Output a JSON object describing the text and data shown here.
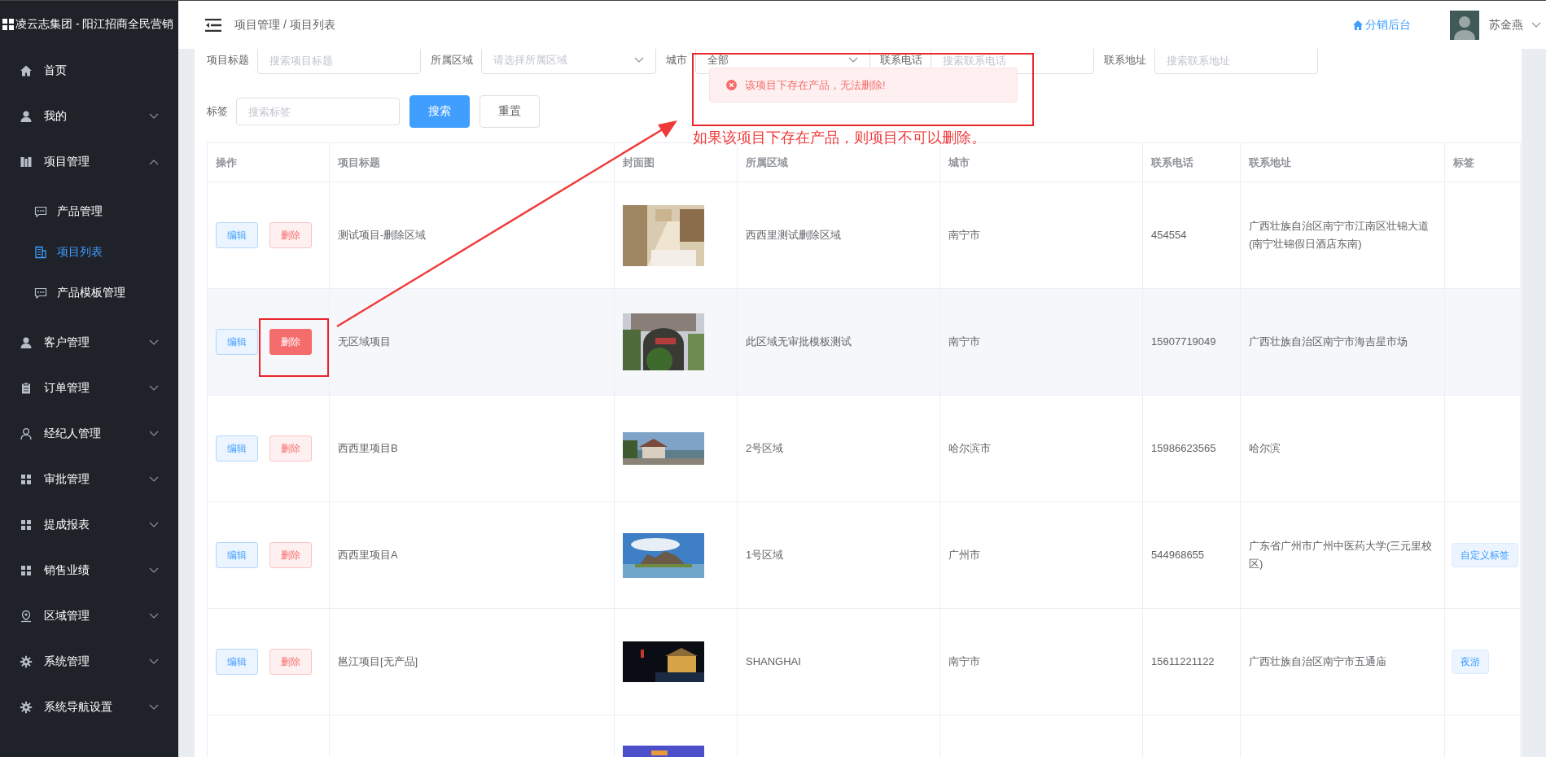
{
  "brand": {
    "title": "凌云志集团 - 阳江招商全民营销"
  },
  "sidebar": {
    "items": [
      {
        "label": "首页"
      },
      {
        "label": "我的",
        "expanded": false
      },
      {
        "label": "项目管理",
        "expanded": true,
        "children": [
          {
            "label": "产品管理",
            "selected": false
          },
          {
            "label": "项目列表",
            "selected": true
          },
          {
            "label": "产品模板管理",
            "selected": false
          }
        ]
      },
      {
        "label": "客户管理",
        "expanded": false
      },
      {
        "label": "订单管理",
        "expanded": false
      },
      {
        "label": "经纪人管理",
        "expanded": false
      },
      {
        "label": "审批管理",
        "expanded": false
      },
      {
        "label": "提成报表",
        "expanded": false
      },
      {
        "label": "销售业绩",
        "expanded": false
      },
      {
        "label": "区域管理",
        "expanded": false
      },
      {
        "label": "系统管理",
        "expanded": false
      },
      {
        "label": "系统导航设置",
        "expanded": false
      }
    ]
  },
  "header": {
    "breadcrumb": "项目管理 / 项目列表",
    "link": "分销后台",
    "user": "苏金燕"
  },
  "filters": [
    {
      "label": "项目标题",
      "placeholder": "搜索项目标题",
      "kind": "input"
    },
    {
      "label": "所属区域",
      "placeholder": "请选择所属区域",
      "kind": "select"
    },
    {
      "label": "城市",
      "value": "全部",
      "kind": "select"
    },
    {
      "label": "联系电话",
      "placeholder": "搜索联系电话",
      "kind": "input"
    },
    {
      "label": "联系地址",
      "placeholder": "搜索联系地址",
      "kind": "input"
    },
    {
      "label": "标签",
      "placeholder": "搜索标签",
      "kind": "input"
    }
  ],
  "buttons": [
    {
      "label": "搜索",
      "kind": "primary"
    },
    {
      "label": "重置",
      "kind": "plain"
    }
  ],
  "toast": {
    "message": "该项目下存在产品，无法删除!",
    "kind": "error"
  },
  "annotation": {
    "note": "如果该项目下存在产品，则项目不可以删除。"
  },
  "table": {
    "columns": [
      "操作",
      "项目标题",
      "封面图",
      "所属区域",
      "城市",
      "联系电话",
      "联系地址",
      "标签"
    ],
    "rows": [
      {
        "edit": "编辑",
        "delete": "删除",
        "highlighted": false,
        "title": "测试项目-删除区域",
        "cover": {
          "kind": "picture"
        },
        "region": "西西里测试删除区域",
        "city": "南宁市",
        "phone": "454554",
        "address": "广西壮族自治区南宁市江南区壮锦大道(南宁壮锦假日酒店东南)"
      },
      {
        "edit": "编辑",
        "delete": "删除",
        "highlighted": true,
        "title": "无区域项目",
        "cover": {
          "kind": "picture"
        },
        "region": "此区域无审批模板测试",
        "city": "南宁市",
        "phone": "15907719049",
        "address": "广西壮族自治区南宁市海吉星市场"
      },
      {
        "edit": "编辑",
        "delete": "删除",
        "highlighted": false,
        "title": "西西里项目B",
        "cover": {
          "kind": "picture"
        },
        "region": "2号区域",
        "city": "哈尔滨市",
        "phone": "15986623565",
        "address": "哈尔滨"
      },
      {
        "edit": "编辑",
        "delete": "删除",
        "highlighted": false,
        "title": "西西里项目A",
        "cover": {
          "kind": "picture"
        },
        "region": "1号区域",
        "city": "广州市",
        "phone": "544968655",
        "address": "广东省广州市广州中医药大学(三元里校区)",
        "tags": [
          "自定义标签"
        ]
      },
      {
        "edit": "编辑",
        "delete": "删除",
        "highlighted": false,
        "title": "邕江项目[无产品]",
        "cover": {
          "kind": "picture"
        },
        "region": "SHANGHAI",
        "city": "南宁市",
        "phone": "15611221122",
        "address": "广西壮族自治区南宁市五通庙",
        "tags": [
          "夜游"
        ]
      },
      {
        "cover": {
          "kind": "picture"
        }
      }
    ]
  }
}
